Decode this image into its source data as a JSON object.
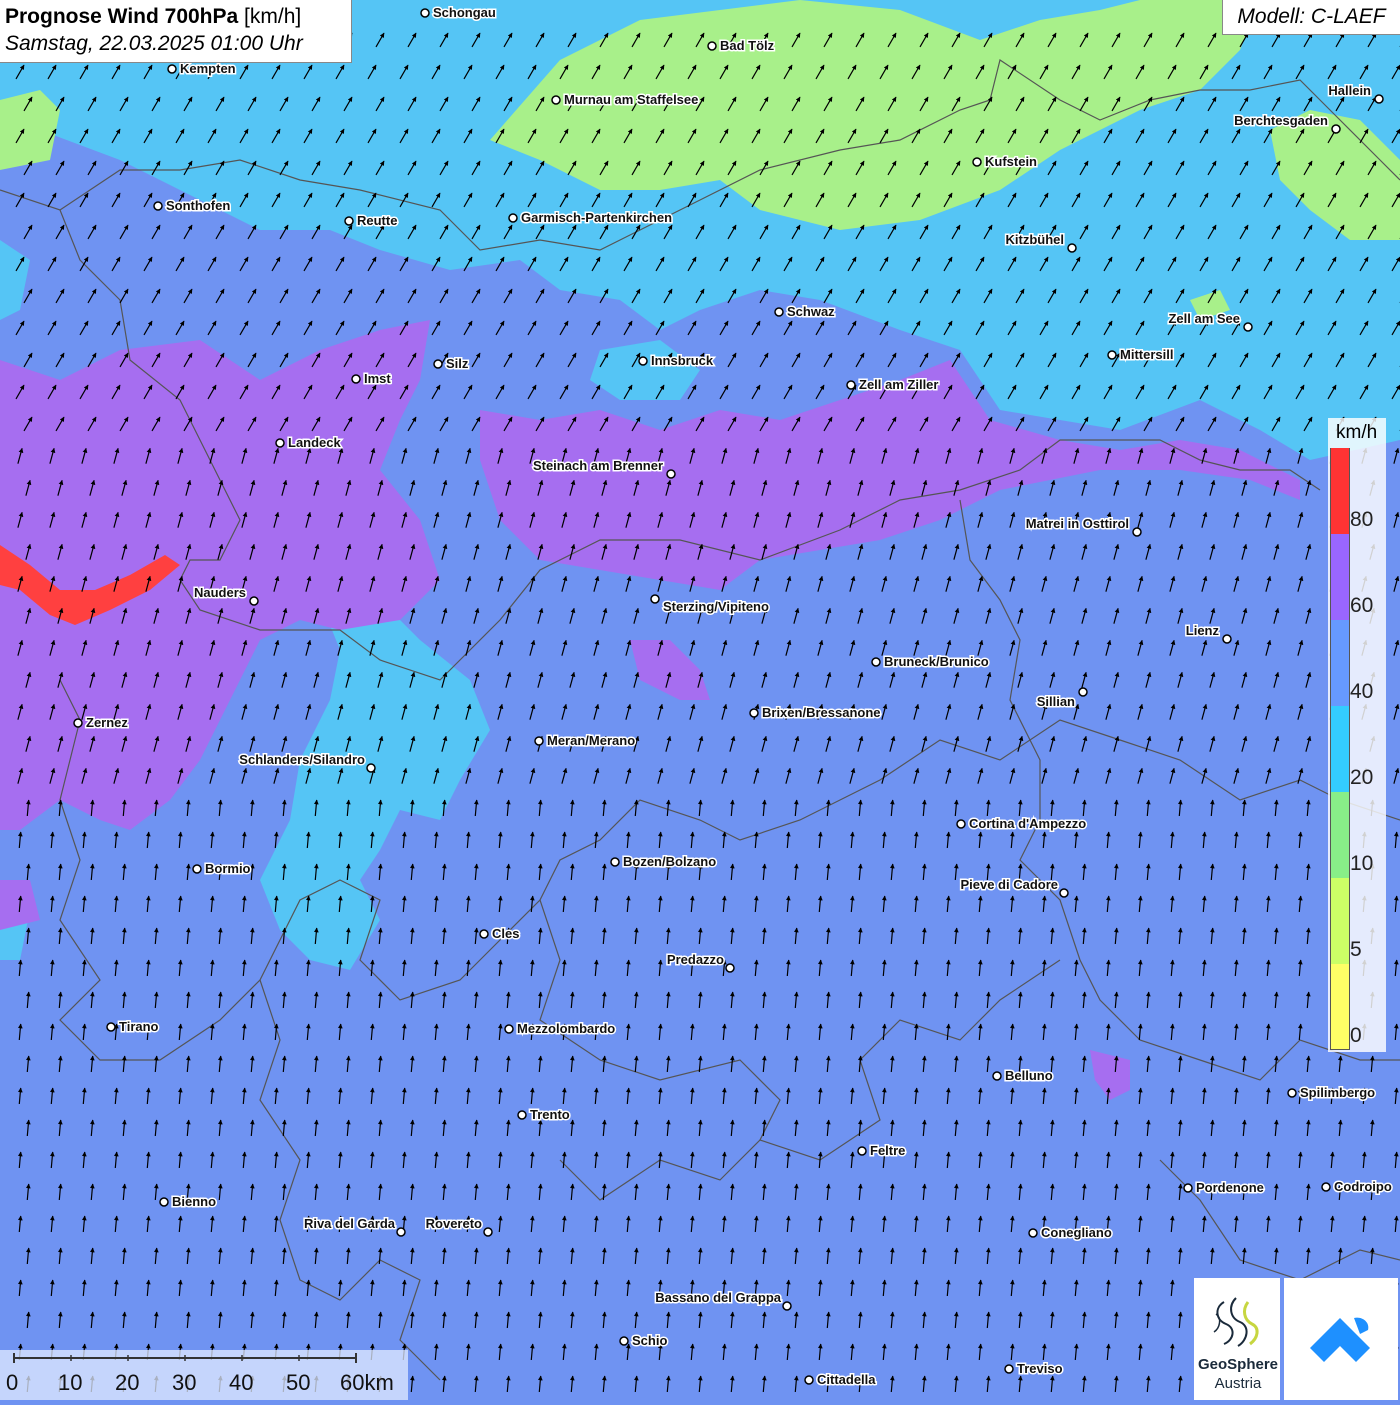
{
  "title": {
    "bold": "Prognose Wind 700hPa",
    "unit": "[km/h]",
    "datetime": "Samstag, 22.03.2025 01:00 Uhr"
  },
  "model": "Modell: C-LAEF",
  "legend": {
    "unit": "km/h",
    "labels": [
      "80",
      "60",
      "40",
      "20",
      "10",
      "5",
      "0"
    ],
    "bins": [
      {
        "from": 0,
        "to": 5,
        "color": "#ffff66"
      },
      {
        "from": 5,
        "to": 10,
        "color": "#ccff66"
      },
      {
        "from": 10,
        "to": 20,
        "color": "#88ee88"
      },
      {
        "from": 20,
        "to": 40,
        "color": "#33ccff"
      },
      {
        "from": 40,
        "to": 60,
        "color": "#6699ff"
      },
      {
        "from": 60,
        "to": 80,
        "color": "#9966ff"
      },
      {
        "from": 80,
        "to": 100,
        "color": "#ff3333"
      }
    ]
  },
  "colors": {
    "ocean_base": "#6f93f2",
    "zone_60_80": "#a66ef0",
    "zone_20_40": "#55c5f5",
    "zone_10_20": "#a8f08a",
    "zone_80_plus": "#ff4040",
    "wind_arrow": "#000000"
  },
  "cities": [
    "Schongau",
    "Bad Tölz",
    "Kempten",
    "Murnau am Staffelsee",
    "Hallein",
    "Berchtesgaden",
    "Kufstein",
    "Sonthofen",
    "Reutte",
    "Garmisch-Partenkirchen",
    "Kitzbühel",
    "Schwaz",
    "Zell am See",
    "Mittersill",
    "Innsbruck",
    "Silz",
    "Imst",
    "Zell am Ziller",
    "Landeck",
    "Steinach am Brenner",
    "Matrei in Osttirol",
    "Nauders",
    "Sterzing/Vipiteno",
    "Lienz",
    "Bruneck/Brunico",
    "Sillian",
    "Zernez",
    "Brixen/Bressanone",
    "Meran/Merano",
    "Schlanders/Silandro",
    "Cortina d'Ampezzo",
    "Bozen/Bolzano",
    "Bormio",
    "Pieve di Cadore",
    "Cles",
    "Predazzo",
    "Tirano",
    "Mezzolombardo",
    "Belluno",
    "Spilimbergo",
    "Trento",
    "Feltre",
    "Pordenone",
    "Codroipo",
    "Bienno",
    "Riva del Garda",
    "Rovereto",
    "Conegliano",
    "Bassano del Grappa",
    "Schio",
    "Treviso",
    "Cittadella"
  ],
  "scale": {
    "labels": [
      "0",
      "10",
      "20",
      "30",
      "40",
      "50",
      "60km"
    ]
  },
  "logo": {
    "brand": "GeoSphere",
    "sub": "Austria"
  }
}
